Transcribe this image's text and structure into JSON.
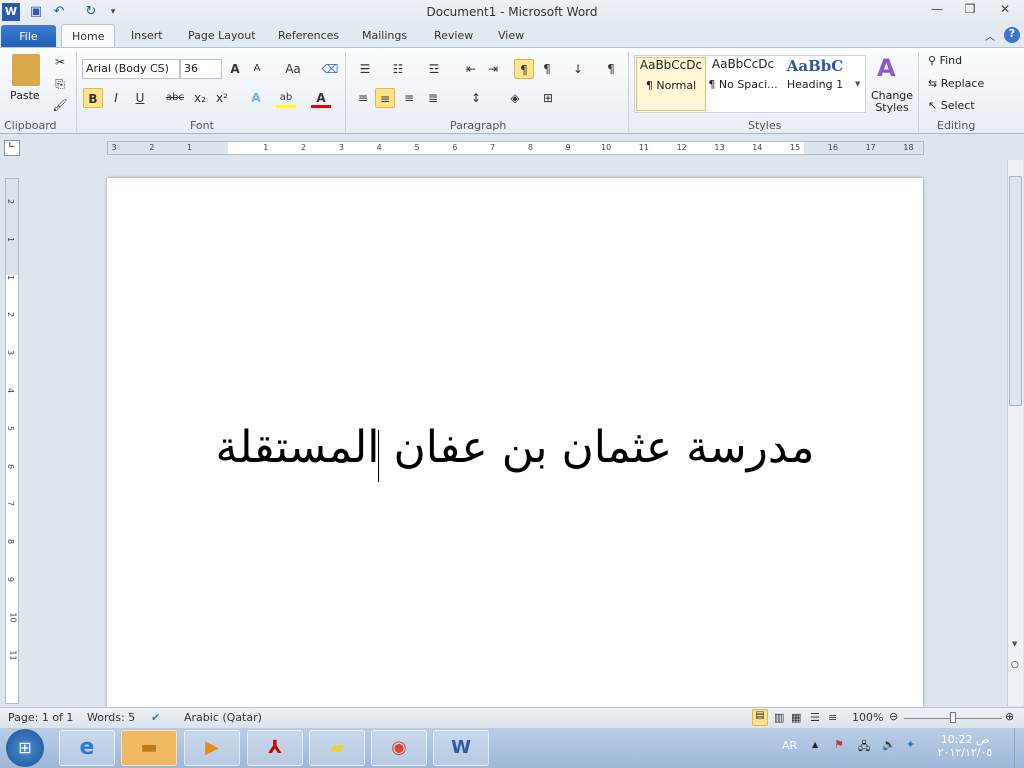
{
  "window": {
    "title": "Document1  -  Microsoft Word"
  },
  "quick_access": {
    "app_icon": "word-icon",
    "save": "save-icon",
    "undo": "undo-icon",
    "redo": "redo-icon",
    "customize": "customize-icon"
  },
  "tabs": [
    "File",
    "Home",
    "Insert",
    "Page Layout",
    "References",
    "Mailings",
    "Review",
    "View"
  ],
  "ribbon": {
    "clipboard": {
      "label": "Clipboard",
      "paste": "Paste"
    },
    "font": {
      "label": "Font",
      "font_name": "Arial (Body CS)",
      "font_size": "36",
      "grow": "A",
      "shrink": "A",
      "change_case": "Aa",
      "bold": "B",
      "italic": "I",
      "underline": "U",
      "strike": "abc",
      "sub": "x₂",
      "sup": "x²",
      "highlight": "ab",
      "color": "A"
    },
    "paragraph": {
      "label": "Paragraph",
      "show_marks": "¶"
    },
    "styles": {
      "label": "Styles",
      "items": [
        {
          "preview": "AaBbCcDc",
          "name": "¶ Normal"
        },
        {
          "preview": "AaBbCcDc",
          "name": "¶ No Spaci..."
        },
        {
          "preview": "AaBbC",
          "name": "Heading 1"
        }
      ],
      "change_styles": "Change Styles"
    },
    "editing": {
      "label": "Editing",
      "find": "Find",
      "replace": "Replace",
      "select": "Select"
    }
  },
  "ruler": {
    "left": [
      "3",
      "2",
      "1"
    ],
    "right": [
      "1",
      "2",
      "3",
      "4",
      "5",
      "6",
      "7",
      "8",
      "9",
      "10",
      "11",
      "12",
      "13",
      "14",
      "15",
      "16",
      "17",
      "18"
    ]
  },
  "vruler": [
    "2",
    "1",
    "1",
    "2",
    "3",
    "4",
    "5",
    "6",
    "7",
    "8",
    "9",
    "10",
    "11"
  ],
  "document": {
    "text": "مدرسة عثمان بن عفان المستقلة"
  },
  "status": {
    "page": "Page: 1 of 1",
    "words": "Words: 5",
    "language": "Arabic (Qatar)",
    "zoom": "100%",
    "zoom_percent": 100
  },
  "taskbar": {
    "apps": [
      "start",
      "internet-explorer",
      "file-explorer",
      "media-player",
      "adobe-reader",
      "sticky-notes",
      "chrome",
      "word"
    ],
    "lang": "AR",
    "time": "10:22 ص",
    "date": "٢٠١٢/١٢/٠٥"
  },
  "colors": {
    "accent": "#2b579a",
    "file_tab": "#2a6bc4",
    "active_button": "#fde38c"
  }
}
